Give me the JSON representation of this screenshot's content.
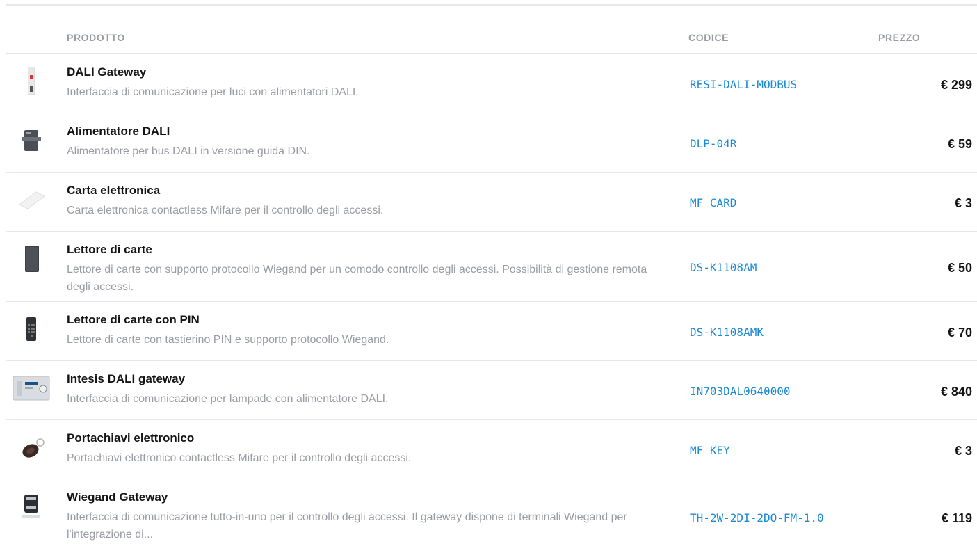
{
  "table": {
    "headers": {
      "product": "PRODOTTO",
      "code": "CODICE",
      "price": "PREZZO"
    },
    "rows": [
      {
        "name": "DALI Gateway",
        "description": "Interfaccia di comunicazione per luci con alimentatori DALI.",
        "code": "RESI-DALI-MODBUS",
        "price": "€ 299",
        "thumbnail_icon": "din-rail-gateway-icon"
      },
      {
        "name": "Alimentatore DALI",
        "description": "Alimentatore per bus DALI in versione guida DIN.",
        "code": "DLP-04R",
        "price": "€ 59",
        "thumbnail_icon": "power-supply-icon"
      },
      {
        "name": "Carta elettronica",
        "description": "Carta elettronica contactless Mifare per il controllo degli accessi.",
        "code": "MF CARD",
        "price": "€ 3",
        "thumbnail_icon": "card-icon"
      },
      {
        "name": "Lettore di carte",
        "description": "Lettore di carte con supporto protocollo Wiegand per un comodo controllo degli accessi. Possibilità di gestione remota degli accessi.",
        "code": "DS-K1108AM",
        "price": "€ 50",
        "thumbnail_icon": "card-reader-icon"
      },
      {
        "name": "Lettore di carte con PIN",
        "description": "Lettore di carte con tastierino PIN e supporto protocollo Wiegand.",
        "code": "DS-K1108AMK",
        "price": "€ 70",
        "thumbnail_icon": "keypad-reader-icon"
      },
      {
        "name": "Intesis DALI gateway",
        "description": "Interfaccia di comunicazione per lampade con alimentatore DALI.",
        "code": "IN703DAL0640000",
        "price": "€ 840",
        "thumbnail_icon": "intesis-gateway-icon"
      },
      {
        "name": "Portachiavi elettronico",
        "description": "Portachiavi elettronico contactless Mifare per il controllo degli accessi.",
        "code": "MF KEY",
        "price": "€ 3",
        "thumbnail_icon": "key-fob-icon"
      },
      {
        "name": "Wiegand Gateway",
        "description": "Interfaccia di comunicazione tutto-in-uno per il controllo degli accessi. Il gateway dispone di terminali Wiegand per l'integrazione di...",
        "code": "TH-2W-2DI-2DO-FM-1.0",
        "price": "€ 119",
        "thumbnail_icon": "wiegand-gateway-icon"
      }
    ]
  },
  "colors": {
    "code_link": "#1a8ad6",
    "muted_text": "#9a9ca5",
    "header_text": "#9a9ca5",
    "name_text": "#141414"
  }
}
